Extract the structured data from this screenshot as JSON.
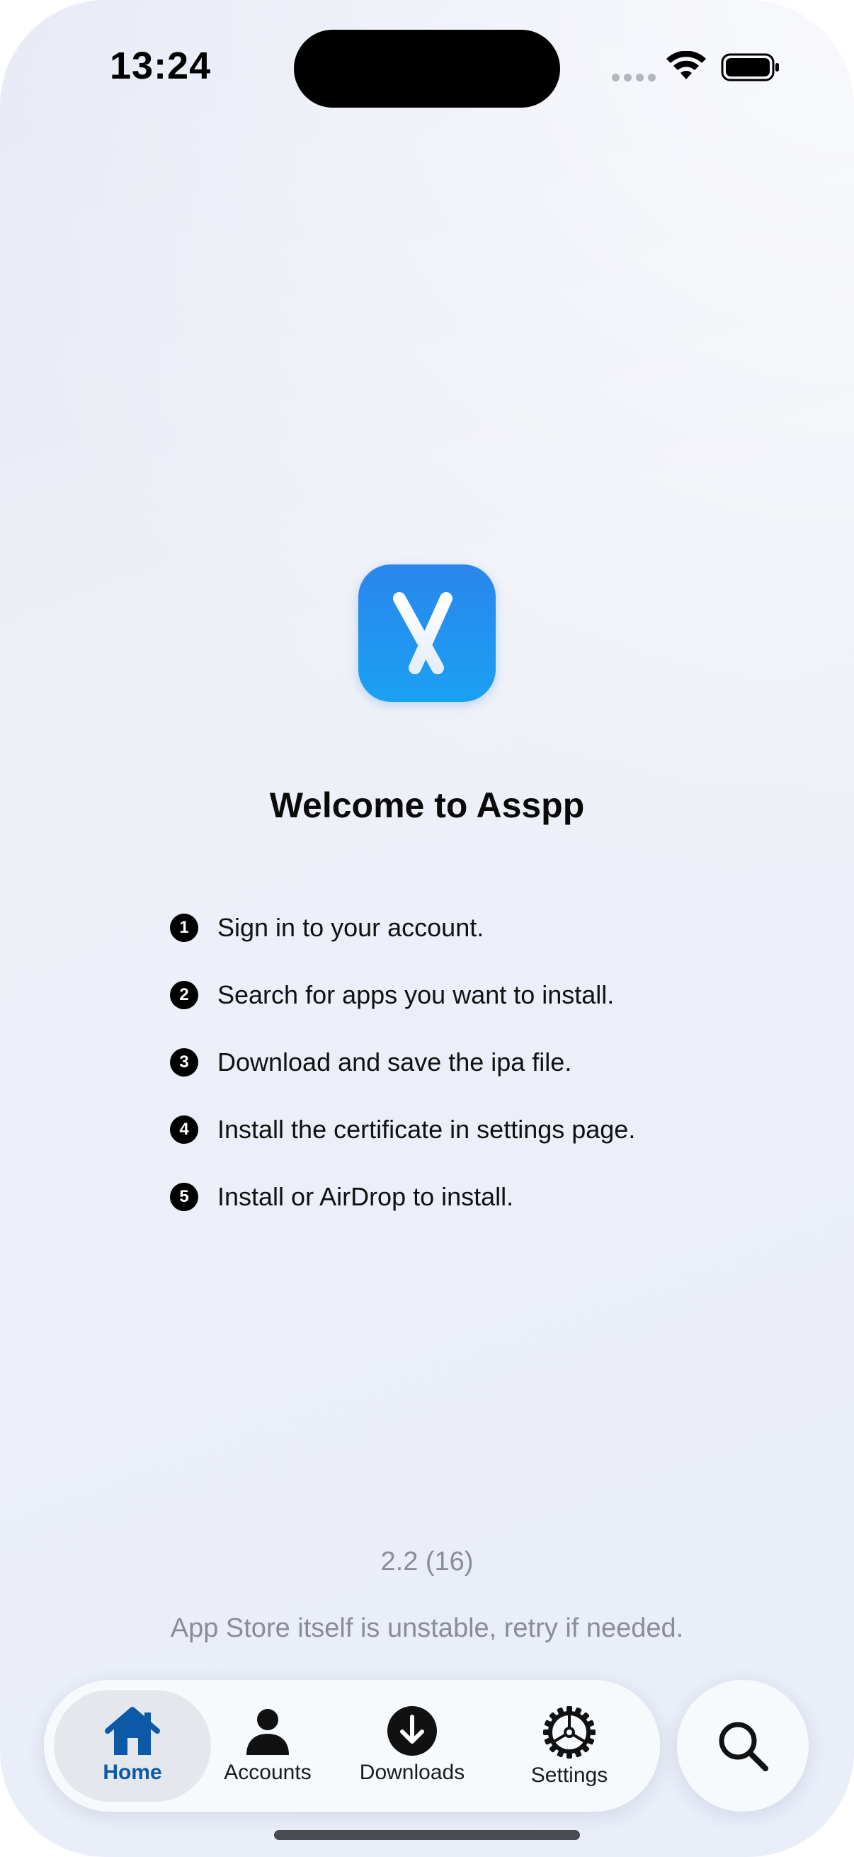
{
  "status_bar": {
    "time": "13:24",
    "icons": [
      "signal-dots-icon",
      "wifi-icon",
      "battery-icon"
    ]
  },
  "app": {
    "icon": "app-logo-icon",
    "accent_color": "#1f8ff0",
    "title": "Welcome to Asspp"
  },
  "steps": [
    {
      "number": "1",
      "text": "Sign in to your account."
    },
    {
      "number": "2",
      "text": "Search for apps you want to install."
    },
    {
      "number": "3",
      "text": "Download and save the ipa file."
    },
    {
      "number": "4",
      "text": "Install the certificate in settings page."
    },
    {
      "number": "5",
      "text": "Install or AirDrop to install."
    }
  ],
  "footer": {
    "version": "2.2 (16)",
    "disclaimer": "App Store itself is unstable, retry if needed."
  },
  "tab_bar": {
    "active_color": "#0c59a8",
    "tabs": [
      {
        "label": "Home",
        "icon": "house-icon",
        "active": true
      },
      {
        "label": "Accounts",
        "icon": "person-icon",
        "active": false
      },
      {
        "label": "Downloads",
        "icon": "download-circle-icon",
        "active": false
      },
      {
        "label": "Settings",
        "icon": "gear-icon",
        "active": false
      }
    ],
    "search_icon": "search-icon"
  }
}
